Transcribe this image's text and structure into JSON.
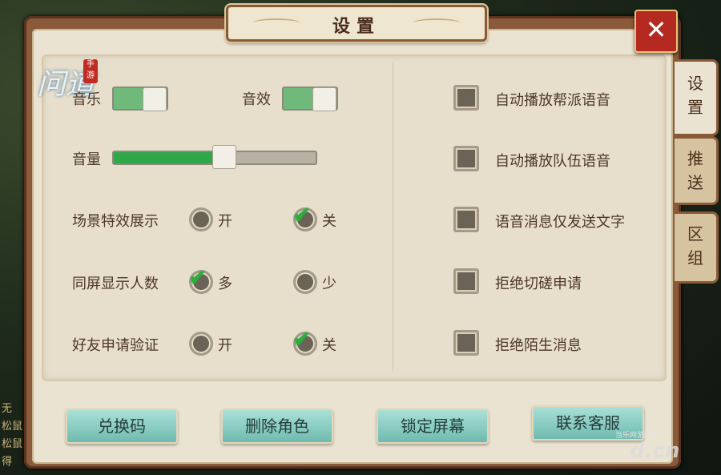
{
  "window": {
    "title": "设置",
    "close_label": "✕"
  },
  "logo": {
    "text": "问道",
    "badge": "手游"
  },
  "tabs": [
    {
      "label_1": "设",
      "label_2": "置",
      "active": true
    },
    {
      "label_1": "推",
      "label_2": "送",
      "active": false
    },
    {
      "label_1": "区",
      "label_2": "组",
      "active": false
    }
  ],
  "settings": {
    "music": {
      "label": "音乐",
      "on": true
    },
    "sfx": {
      "label": "音效",
      "on": true
    },
    "volume": {
      "label": "音量",
      "level": 0.55
    },
    "scene_effects": {
      "label": "场景特效展示",
      "options": [
        "开",
        "关"
      ],
      "selected": "关"
    },
    "screen_players": {
      "label": "同屏显示人数",
      "options": [
        "多",
        "少"
      ],
      "selected": "多"
    },
    "friend_verify": {
      "label": "好友申请验证",
      "options": [
        "开",
        "关"
      ],
      "selected": "关"
    }
  },
  "checkboxes": [
    {
      "label": "自动播放帮派语音",
      "checked": false
    },
    {
      "label": "自动播放队伍语音",
      "checked": false
    },
    {
      "label": "语音消息仅发送文字",
      "checked": false
    },
    {
      "label": "拒绝切磋申请",
      "checked": false
    },
    {
      "label": "拒绝陌生消息",
      "checked": false
    }
  ],
  "buttons": {
    "redeem": "兑换码",
    "delete_role": "删除角色",
    "lock_screen": "锁定屏幕",
    "contact_service": "联系客服"
  },
  "background": {
    "left_text": [
      "无",
      "松鼠",
      "松鼠",
      "得"
    ]
  },
  "watermark": {
    "small": "当乐网游门户",
    "big": "d.cn"
  }
}
